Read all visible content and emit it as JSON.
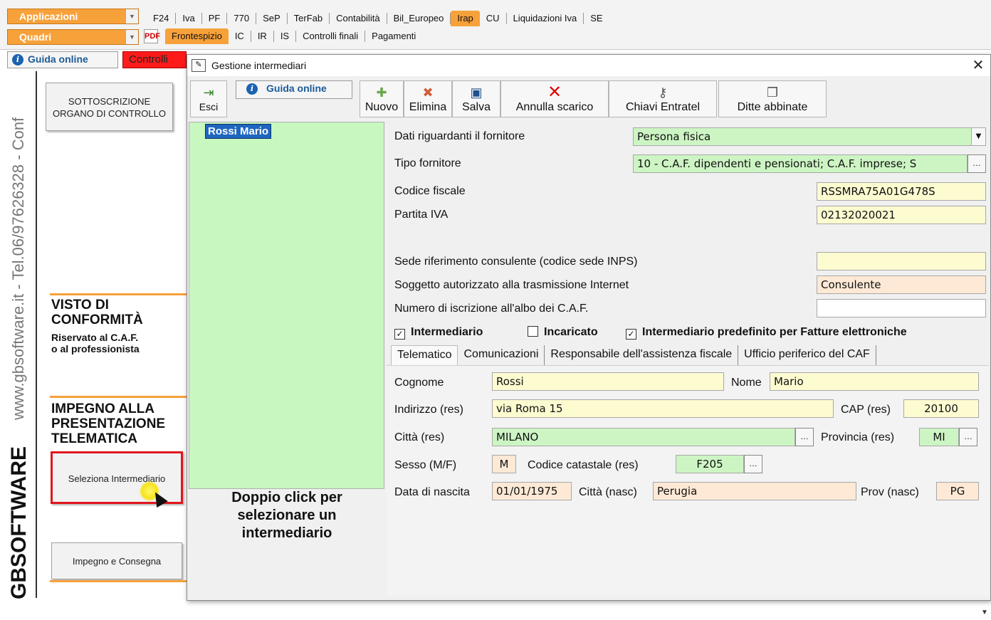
{
  "ribbon": {
    "combo1": "Applicazioni",
    "combo2": "Quadri",
    "tabs_row1": [
      "F24",
      "Iva",
      "PF",
      "770",
      "SeP",
      "TerFab",
      "Contabilità",
      "Bil_Europeo",
      "Irap",
      "CU",
      "Liquidazioni Iva",
      "SE"
    ],
    "active_row1": "Irap",
    "tabs_row2": [
      "Frontespizio",
      "IC",
      "IR",
      "IS",
      "Controlli finali",
      "Pagamenti"
    ],
    "active_row2": "Frontespizio"
  },
  "left_panel": {
    "guida_label": "Guida online",
    "controlli_label": "Controlli",
    "vertical_text": "www.gbsoftware.it - Tel.06/97626328 - Conf",
    "logo_text": "GBSOFTWARE",
    "sottoscrizione": "SOTTOSCRIZIONE\nORGANO DI CONTROLLO",
    "visto_title": "VISTO DI\nCONFORMITÀ",
    "visto_sub": "Riservato al C.A.F.\no al professionista",
    "impegno_title": "IMPEGNO ALLA\nPRESENTAZIONE\nTELEMATICA",
    "seleziona_btn": "Seleziona Intermediario",
    "consegna_btn": "Impegno e Consegna"
  },
  "dialog": {
    "title": "Gestione intermediari",
    "toolbar": {
      "esci": "Esci",
      "guida": "Guida online",
      "nuovo": "Nuovo",
      "elimina": "Elimina",
      "salva": "Salva",
      "annulla": "Annulla scarico",
      "chiavi": "Chiavi Entratel",
      "ditte": "Ditte abbinate"
    },
    "list": {
      "items": [
        "Rossi  Mario"
      ],
      "hint": "Doppio click per selezionare un intermediario"
    },
    "form": {
      "dati_label": "Dati riguardanti il fornitore",
      "dati_value": "Persona fisica",
      "tipo_label": "Tipo fornitore",
      "tipo_value": "10 - C.A.F. dipendenti e pensionati; C.A.F. imprese; S",
      "cf_label": "Codice fiscale",
      "cf_value": "RSSMRA75A01G478S",
      "piva_label": "Partita IVA",
      "piva_value": "02132020021",
      "sede_label": "Sede riferimento consulente (codice sede INPS)",
      "sede_value": "",
      "sogg_label": "Soggetto autorizzato alla trasmissione Internet",
      "sogg_value": "Consulente",
      "num_label": "Numero di iscrizione all'albo dei C.A.F.",
      "num_value": "",
      "chk_intermediario": "Intermediario",
      "chk_incaricato": "Incaricato",
      "chk_predefinito": "Intermediario predefinito per Fatture elettroniche",
      "chk_intermediario_checked": true,
      "chk_incaricato_checked": false,
      "chk_predefinito_checked": true
    },
    "tabs": [
      "Telematico",
      "Comunicazioni",
      "Responsabile dell'assistenza fiscale",
      "Ufficio periferico del CAF"
    ],
    "telematico": {
      "cognome_label": "Cognome",
      "cognome": "Rossi",
      "nome_label": "Nome",
      "nome": "Mario",
      "indirizzo_label": "Indirizzo (res)",
      "indirizzo": "via Roma 15",
      "cap_label": "CAP (res)",
      "cap": "20100",
      "citta_label": "Città (res)",
      "citta": "MILANO",
      "prov_label": "Provincia (res)",
      "prov": "MI",
      "sesso_label": "Sesso (M/F)",
      "sesso": "M",
      "catastale_label": "Codice catastale (res)",
      "catastale": "F205",
      "nascita_label": "Data di nascita",
      "nascita": "01/01/1975",
      "citta_nasc_label": "Città (nasc)",
      "citta_nasc": "Perugia",
      "prov_nasc_label": "Prov (nasc)",
      "prov_nasc": "PG"
    }
  },
  "colors": {
    "orange": "#f7a13a",
    "green_field": "#cdf5c4",
    "yellow_field": "#fdfbd0",
    "peach_field": "#fde9d5",
    "accent_blue": "#1b62b0",
    "controlli_red": "#ff1a1a"
  }
}
